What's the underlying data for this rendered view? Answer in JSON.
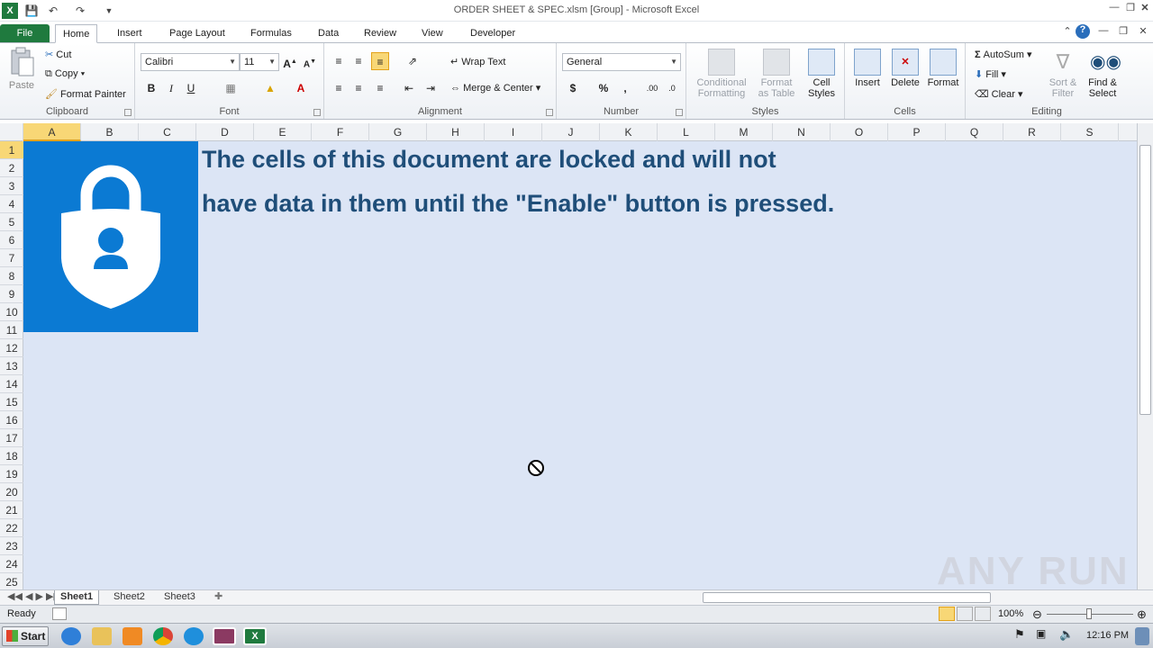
{
  "window": {
    "title": "ORDER SHEET & SPEC.xlsm  [Group]  -  Microsoft Excel"
  },
  "tabs": [
    "File",
    "Home",
    "Insert",
    "Page Layout",
    "Formulas",
    "Data",
    "Review",
    "View",
    "Developer"
  ],
  "ribbon": {
    "clipboard": {
      "label": "Clipboard",
      "paste": "Paste",
      "cut": "Cut",
      "copy": "Copy",
      "format_painter": "Format Painter"
    },
    "font": {
      "label": "Font",
      "family": "Calibri",
      "size": "11"
    },
    "alignment": {
      "label": "Alignment",
      "wrap_text": "Wrap Text",
      "merge_center": "Merge & Center"
    },
    "number": {
      "label": "Number",
      "format": "General"
    },
    "styles": {
      "label": "Styles",
      "conditional_formatting_l1": "Conditional",
      "conditional_formatting_l2": "Formatting",
      "format_as_table_l1": "Format",
      "format_as_table_l2": "as Table",
      "cell_styles_l1": "Cell",
      "cell_styles_l2": "Styles"
    },
    "cells": {
      "label": "Cells",
      "insert": "Insert",
      "delete": "Delete",
      "format": "Format"
    },
    "editing": {
      "label": "Editing",
      "autosum": "AutoSum",
      "fill": "Fill",
      "clear": "Clear",
      "sort_filter_l1": "Sort &",
      "sort_filter_l2": "Filter",
      "find_select_l1": "Find &",
      "find_select_l2": "Select"
    }
  },
  "columns": [
    "A",
    "B",
    "C",
    "D",
    "E",
    "F",
    "G",
    "H",
    "I",
    "J",
    "K",
    "L",
    "M",
    "N",
    "O",
    "P",
    "Q",
    "R",
    "S"
  ],
  "rows": [
    "1",
    "2",
    "3",
    "4",
    "5",
    "6",
    "7",
    "8",
    "9",
    "10",
    "11",
    "12",
    "13",
    "14",
    "15",
    "16",
    "17",
    "18",
    "19",
    "20",
    "21",
    "22",
    "23",
    "24",
    "25"
  ],
  "message": {
    "line1": "The cells of this document are locked and will not",
    "line2": "have data in them until the \"Enable\" button is pressed."
  },
  "sheets": [
    "Sheet1",
    "Sheet2",
    "Sheet3"
  ],
  "status": {
    "ready": "Ready",
    "zoom": "100%"
  },
  "taskbar": {
    "start": "Start",
    "time": "12:16 PM"
  },
  "watermark": "ANY RUN",
  "colors": {
    "lock_blue": "#0b7ad3",
    "message_text": "#1f4e79",
    "sheet_bg": "#dce5f5",
    "file_tab": "#1f7a3e"
  }
}
